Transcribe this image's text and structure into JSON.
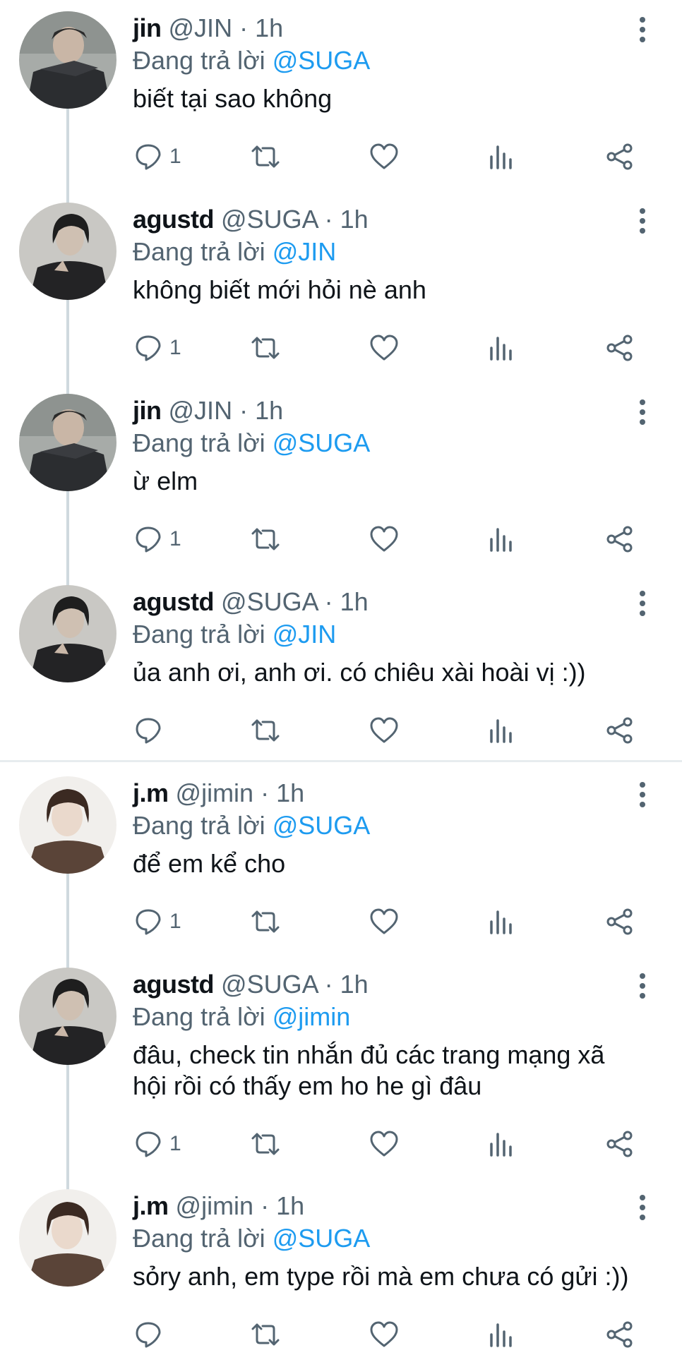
{
  "colors": {
    "link": "#1d9bf0",
    "secondary_text": "#536471",
    "primary_text": "#0f1419",
    "thread_line": "#cfd9de"
  },
  "icons": {
    "reply": "comment-bubble-icon",
    "retweet": "retweet-icon",
    "like": "heart-icon",
    "views": "bar-chart-icon",
    "share": "share-icon",
    "more": "more-vertical-icon"
  },
  "tweets": [
    {
      "name": "jin",
      "handle": "@JIN",
      "separator": "·",
      "time": "1h",
      "reply_prefix": "Đang trả lời ",
      "reply_to": "@SUGA",
      "text": "biết tại sao không",
      "reply_count": "1"
    },
    {
      "name": "agustd",
      "handle": "@SUGA",
      "separator": "·",
      "time": "1h",
      "reply_prefix": "Đang trả lời ",
      "reply_to": "@JIN",
      "text": "không biết mới hỏi nè anh",
      "reply_count": "1"
    },
    {
      "name": "jin",
      "handle": "@JIN",
      "separator": "·",
      "time": "1h",
      "reply_prefix": "Đang trả lời ",
      "reply_to": "@SUGA",
      "text": "ừ elm",
      "reply_count": "1"
    },
    {
      "name": "agustd",
      "handle": "@SUGA",
      "separator": "·",
      "time": "1h",
      "reply_prefix": "Đang trả lời ",
      "reply_to": "@JIN",
      "text": "ủa anh ơi, anh ơi. có chiêu xài hoài vị :))",
      "reply_count": ""
    },
    {
      "name": "j.m",
      "handle": "@jimin",
      "separator": "·",
      "time": "1h",
      "reply_prefix": "Đang trả lời ",
      "reply_to": "@SUGA",
      "text": "để em kể cho",
      "reply_count": "1"
    },
    {
      "name": "agustd",
      "handle": "@SUGA",
      "separator": "·",
      "time": "1h",
      "reply_prefix": "Đang trả lời ",
      "reply_to": "@jimin",
      "text": "đâu, check tin nhắn đủ các trang mạng xã hội rồi có thấy em ho he gì đâu",
      "reply_count": "1"
    },
    {
      "name": "j.m",
      "handle": "@jimin",
      "separator": "·",
      "time": "1h",
      "reply_prefix": "Đang trả lời ",
      "reply_to": "@SUGA",
      "text": "sỏry anh, em type rồi mà em chưa có gửi :))",
      "reply_count": ""
    }
  ]
}
